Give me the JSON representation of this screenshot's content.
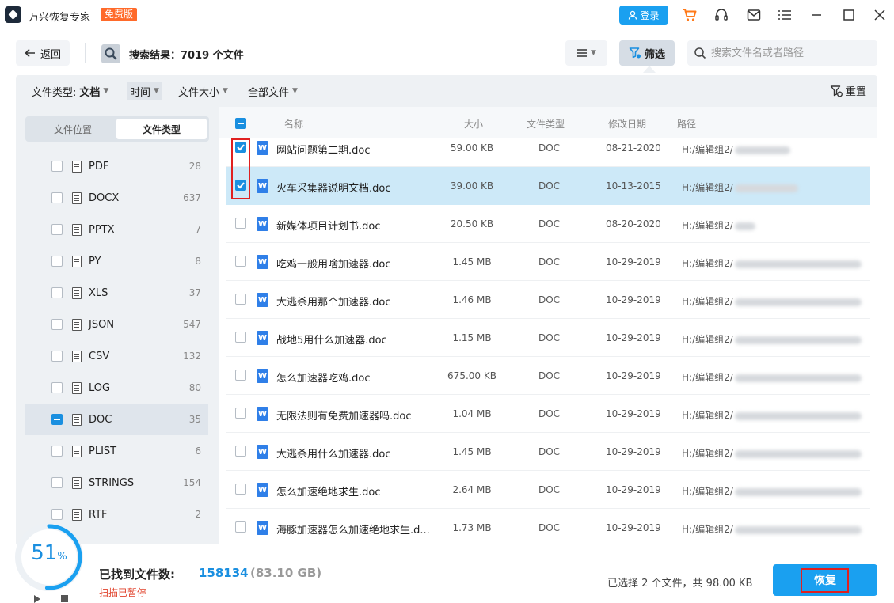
{
  "app": {
    "name": "万兴恢复专家",
    "badge": "免费版",
    "login_label": "登录"
  },
  "toolbar": {
    "back_label": "返回",
    "search_result_label": "搜索结果：",
    "search_result_count": "7019",
    "search_result_unit": "个文件",
    "filter_label": "筛选",
    "search_placeholder": "搜索文件名或者路径"
  },
  "filterbar": {
    "file_type_label": "文件类型: ",
    "file_type_value": "文档",
    "time_label": "时间",
    "size_label": "文件大小",
    "all_files_label": "全部文件",
    "reset_label": "重置"
  },
  "sidebar": {
    "tabs": [
      "文件位置",
      "文件类型"
    ],
    "active_tab": "文件类型",
    "types": [
      {
        "name": "PDF",
        "count": "28"
      },
      {
        "name": "DOCX",
        "count": "637"
      },
      {
        "name": "PPTX",
        "count": "7"
      },
      {
        "name": "PY",
        "count": "8"
      },
      {
        "name": "XLS",
        "count": "37"
      },
      {
        "name": "JSON",
        "count": "547"
      },
      {
        "name": "CSV",
        "count": "132"
      },
      {
        "name": "LOG",
        "count": "80"
      },
      {
        "name": "DOC",
        "count": "35"
      },
      {
        "name": "PLIST",
        "count": "6"
      },
      {
        "name": "STRINGS",
        "count": "154"
      },
      {
        "name": "RTF",
        "count": "2"
      }
    ],
    "selected_type": "DOC"
  },
  "list": {
    "headers": {
      "name": "名称",
      "size": "大小",
      "type": "文件类型",
      "date": "修改日期",
      "path": "路径"
    },
    "rows": [
      {
        "name": "网站问题第二期.doc",
        "size": "59.00 KB",
        "type": "DOC",
        "date": "08-21-2020",
        "path": "H:/编辑组2/",
        "checked": true
      },
      {
        "name": "火车采集器说明文档.doc",
        "size": "39.00 KB",
        "type": "DOC",
        "date": "10-13-2015",
        "path": "H:/编辑组2/",
        "checked": true
      },
      {
        "name": "新媒体项目计划书.doc",
        "size": "20.50 KB",
        "type": "DOC",
        "date": "08-20-2020",
        "path": "H:/编辑组2/",
        "checked": false
      },
      {
        "name": "吃鸡一般用啥加速器.doc",
        "size": "1.45 MB",
        "type": "DOC",
        "date": "10-29-2019",
        "path": "H:/编辑组2/",
        "checked": false
      },
      {
        "name": "大逃杀用那个加速器.doc",
        "size": "1.46 MB",
        "type": "DOC",
        "date": "10-29-2019",
        "path": "H:/编辑组2/",
        "checked": false
      },
      {
        "name": "战地5用什么加速器.doc",
        "size": "1.15 MB",
        "type": "DOC",
        "date": "10-29-2019",
        "path": "H:/编辑组2/",
        "checked": false
      },
      {
        "name": "怎么加速器吃鸡.doc",
        "size": "675.00 KB",
        "type": "DOC",
        "date": "10-29-2019",
        "path": "H:/编辑组2/",
        "checked": false
      },
      {
        "name": "无限法则有免费加速器吗.doc",
        "size": "1.04 MB",
        "type": "DOC",
        "date": "10-29-2019",
        "path": "H:/编辑组2/",
        "checked": false
      },
      {
        "name": "大逃杀用什么加速器.doc",
        "size": "1.45 MB",
        "type": "DOC",
        "date": "10-29-2019",
        "path": "H:/编辑组2/",
        "checked": false
      },
      {
        "name": "怎么加速绝地求生.doc",
        "size": "2.64 MB",
        "type": "DOC",
        "date": "10-29-2019",
        "path": "H:/编辑组2/",
        "checked": false
      },
      {
        "name": "海豚加速器怎么加速绝地求生.d...",
        "size": "1.73 MB",
        "type": "DOC",
        "date": "10-29-2019",
        "path": "H:/编辑组2/",
        "checked": false
      }
    ]
  },
  "footer": {
    "progress_value": "51",
    "progress_unit": "%",
    "found_label": "已找到文件数:",
    "found_count": "158134",
    "found_size": "(83.10 GB)",
    "scan_status": "扫描已暂停",
    "selected_summary": "已选择 2 个文件，共 98.00 KB",
    "recover_label": "恢复"
  },
  "colors": {
    "accent": "#1aa0f0",
    "badge": "#ff6a2a",
    "highlight_row": "#cde9f8",
    "annotation_red": "#e02020"
  }
}
